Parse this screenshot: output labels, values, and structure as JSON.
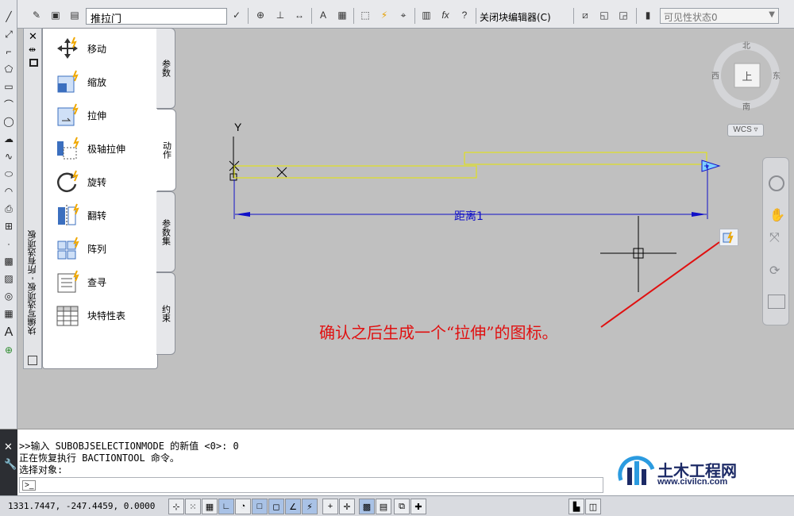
{
  "toolbar": {
    "block_name": "推拉门",
    "close_block_editor": "关闭块编辑器(C)",
    "visibility_state": "可见性状态0"
  },
  "palette": {
    "title": "块编写选项板 - 所有选项板",
    "tabs": [
      "参数",
      "动作",
      "参数集",
      "约束"
    ],
    "actions": [
      "移动",
      "缩放",
      "拉伸",
      "极轴拉伸",
      "旋转",
      "翻转",
      "阵列",
      "查寻",
      "块特性表"
    ]
  },
  "viewcube": {
    "north": "北",
    "south": "南",
    "east": "东",
    "west": "西",
    "face": "上",
    "ucs": "WCS"
  },
  "drawing": {
    "y_axis": "Y",
    "dimension_label": "距离1",
    "annotation": "确认之后生成一个“拉伸”的图标。"
  },
  "command": {
    "lines": [
      ">>输入 SUBOBJSELECTIONMODE 的新值 <0>: 0",
      "正在恢复执行 BACTIONTOOL 命令。",
      "选择对象:"
    ]
  },
  "status": {
    "coordinates": "1331.7447, -247.4459, 0.0000"
  },
  "watermark": {
    "name": "土木工程网",
    "url": "www.civilcn.com"
  },
  "colors": {
    "canvas": "#c0c0c0",
    "geometry": "#e6e600",
    "dimension": "#1010c8",
    "annotation": "#e01010"
  }
}
